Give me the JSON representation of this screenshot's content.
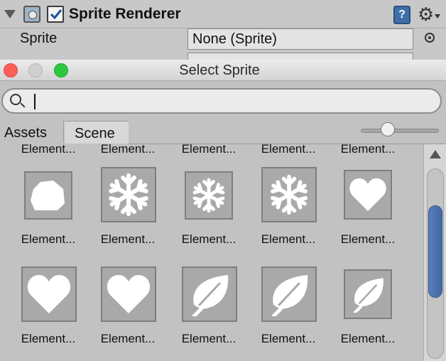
{
  "inspector": {
    "component_title": "Sprite Renderer",
    "enabled": true,
    "help_glyph": "?",
    "gear_glyph": "⚙",
    "sprite_label": "Sprite",
    "sprite_value": "None (Sprite)"
  },
  "window": {
    "title": "Select Sprite",
    "search": {
      "value": "",
      "placeholder": ""
    },
    "tabs": [
      {
        "label": "Assets",
        "active": true
      },
      {
        "label": "Scene",
        "active": false
      }
    ],
    "zoom_level": 0.25
  },
  "grid": {
    "top_row_labels": [
      "Element...",
      "Element...",
      "Element...",
      "Element...",
      "Element..."
    ],
    "row1": [
      {
        "label": "Element...",
        "icon": "rock-icon"
      },
      {
        "label": "Element...",
        "icon": "snowflake-icon"
      },
      {
        "label": "Element...",
        "icon": "snowflake-icon"
      },
      {
        "label": "Element...",
        "icon": "snowflake-icon"
      },
      {
        "label": "Element...",
        "icon": "heart-icon"
      }
    ],
    "row2": [
      {
        "label": "Element...",
        "icon": "heart-icon"
      },
      {
        "label": "Element...",
        "icon": "heart-icon"
      },
      {
        "label": "Element...",
        "icon": "leaf-icon"
      },
      {
        "label": "Element...",
        "icon": "leaf-icon"
      },
      {
        "label": "Element...",
        "icon": "leaf-icon"
      }
    ]
  },
  "colors": {
    "scroll_thumb": "#4a72b0",
    "close": "#fc5f57",
    "maximize": "#2dc840"
  }
}
